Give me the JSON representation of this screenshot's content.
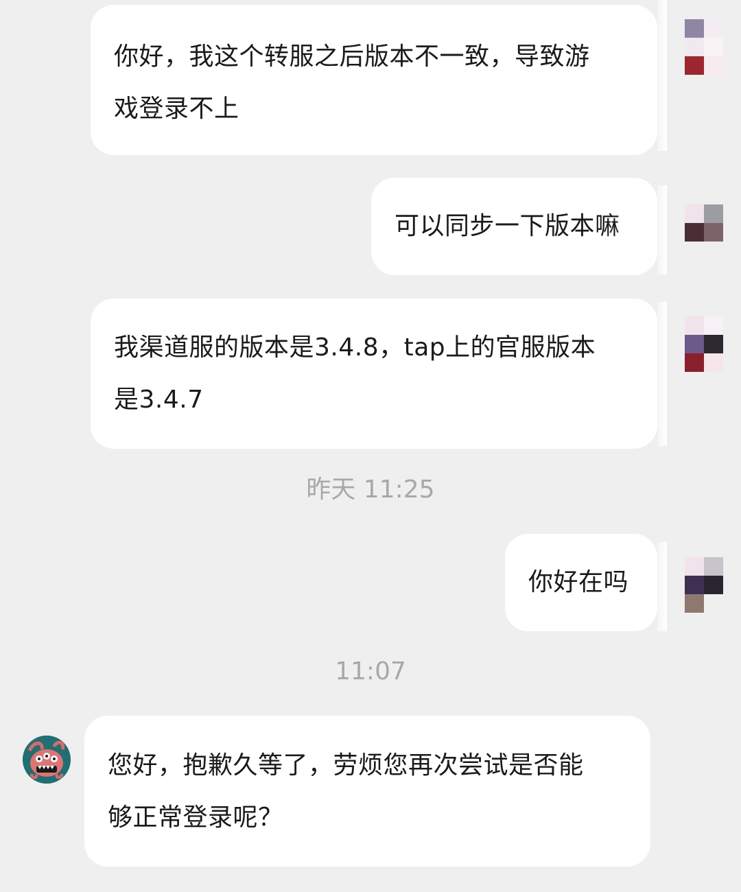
{
  "messages": [
    {
      "sender": "user",
      "text": "你好，我这个转服之后版本不一致，导致游\n戏登录不上"
    },
    {
      "sender": "user",
      "text": "可以同步一下版本嘛"
    },
    {
      "sender": "user",
      "text": "我渠道服的版本是3.4.8，tap上的官服版本\n是3.4.7"
    },
    {
      "sender": "user",
      "text": "你好在吗"
    },
    {
      "sender": "agent",
      "text": "您好，抱歉久等了，劳烦您再次尝试是否能\n够正常登录呢？"
    }
  ],
  "timestamps": [
    "昨天 11:25",
    "11:07"
  ],
  "colors": {
    "background": "#efefef",
    "bubble": "#ffffff",
    "text": "#1a1a1a",
    "timestamp": "#a8a8a8"
  }
}
